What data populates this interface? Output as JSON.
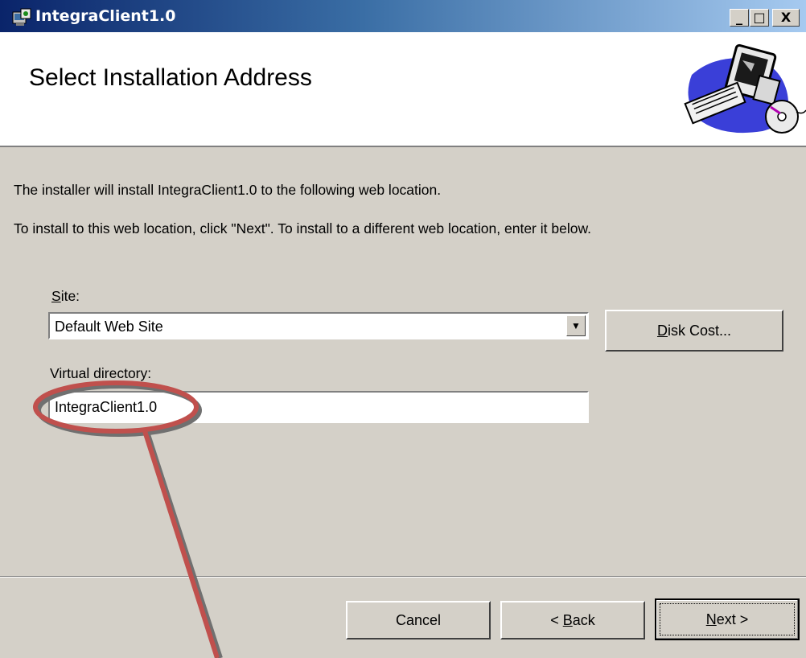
{
  "window": {
    "title": "IntegraClient1.0",
    "controls": {
      "minimize": "_",
      "maximize": "□",
      "close": "X"
    }
  },
  "header": {
    "title": "Select Installation Address",
    "art_icon": "computer-cd-icon"
  },
  "body": {
    "line1": "The installer will install IntegraClient1.0 to the following web location.",
    "line2": "To install to this web location, click \"Next\". To install to a different web location, enter it below."
  },
  "site": {
    "label_prefix": "S",
    "label_rest": "ite:",
    "value": "Default Web Site"
  },
  "disk_cost": {
    "prefix": "D",
    "rest": "isk Cost..."
  },
  "virtual_dir": {
    "label": "Virtual directory:",
    "value": "IntegraClient1.0"
  },
  "buttons": {
    "cancel": "Cancel",
    "back_pre": "< ",
    "back_u": "B",
    "back_rest": "ack",
    "next_u": "N",
    "next_rest": "ext >"
  },
  "colors": {
    "dialog_bg": "#d4d0c8",
    "title_start": "#0a246a",
    "title_end": "#a6caf0",
    "annotation": "#c0504d"
  }
}
